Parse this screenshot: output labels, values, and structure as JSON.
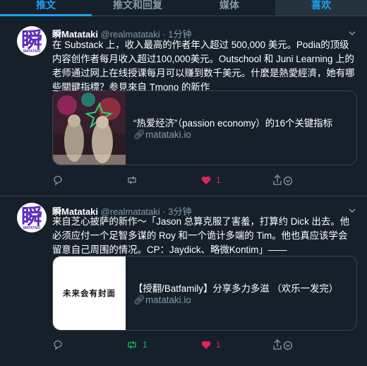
{
  "tabs": [
    {
      "label": "推文"
    },
    {
      "label": "推文和回复"
    },
    {
      "label": "媒体"
    },
    {
      "label": "喜欢"
    }
  ],
  "tweets": [
    {
      "avatar_glyph": "瞬",
      "avatar_sub": "MATATAKI",
      "display_name": "瞬Matataki",
      "handle": "@realmatataki",
      "time": "· 1分钟",
      "text": "在 Substack 上，收入最高的作者年入超过 500,000 美元。Podia的顶级内容创作者每月收入超过100,000美元。Outschool 和 Juni Learning 上的老师通过网上在线授课每月可以赚到数千美元。什麼是熱愛經濟，她有哪些關鍵指標？参見來自 Tmono 的新作",
      "card": {
        "title": "“热爱经济”（passion economy）的16个关键指标",
        "domain": "matataki.io"
      },
      "actions": {
        "reply": "",
        "retweet": "",
        "like": "1"
      }
    },
    {
      "avatar_glyph": "瞬",
      "avatar_sub": "MATATAKI",
      "display_name": "瞬Matataki",
      "handle": "@realmatataki",
      "time": "· 3分钟",
      "text": "来自芝心披萨的新作～「Jason 总算克服了害羞，打算约 Dick 出去。他必须应付一个足智多谋的 Roy 和一个诡计多端的 Tim。他也真应该学会留意自己周围的情况。CP：Jaydick、略微Kontim」——",
      "card": {
        "title": "【授翻/Batfamily】分享多力多滋 （欢乐一发完）",
        "domain": "matataki.io",
        "thumb_text": "未来会有封面"
      },
      "actions": {
        "reply": "",
        "retweet": "1",
        "like": "1"
      }
    }
  ],
  "colors": {
    "background": "#15202b",
    "accent": "#1da1f2",
    "muted": "#8899a6",
    "like": "#e0245e",
    "retweet": "#17bf63",
    "border": "#38444d"
  }
}
